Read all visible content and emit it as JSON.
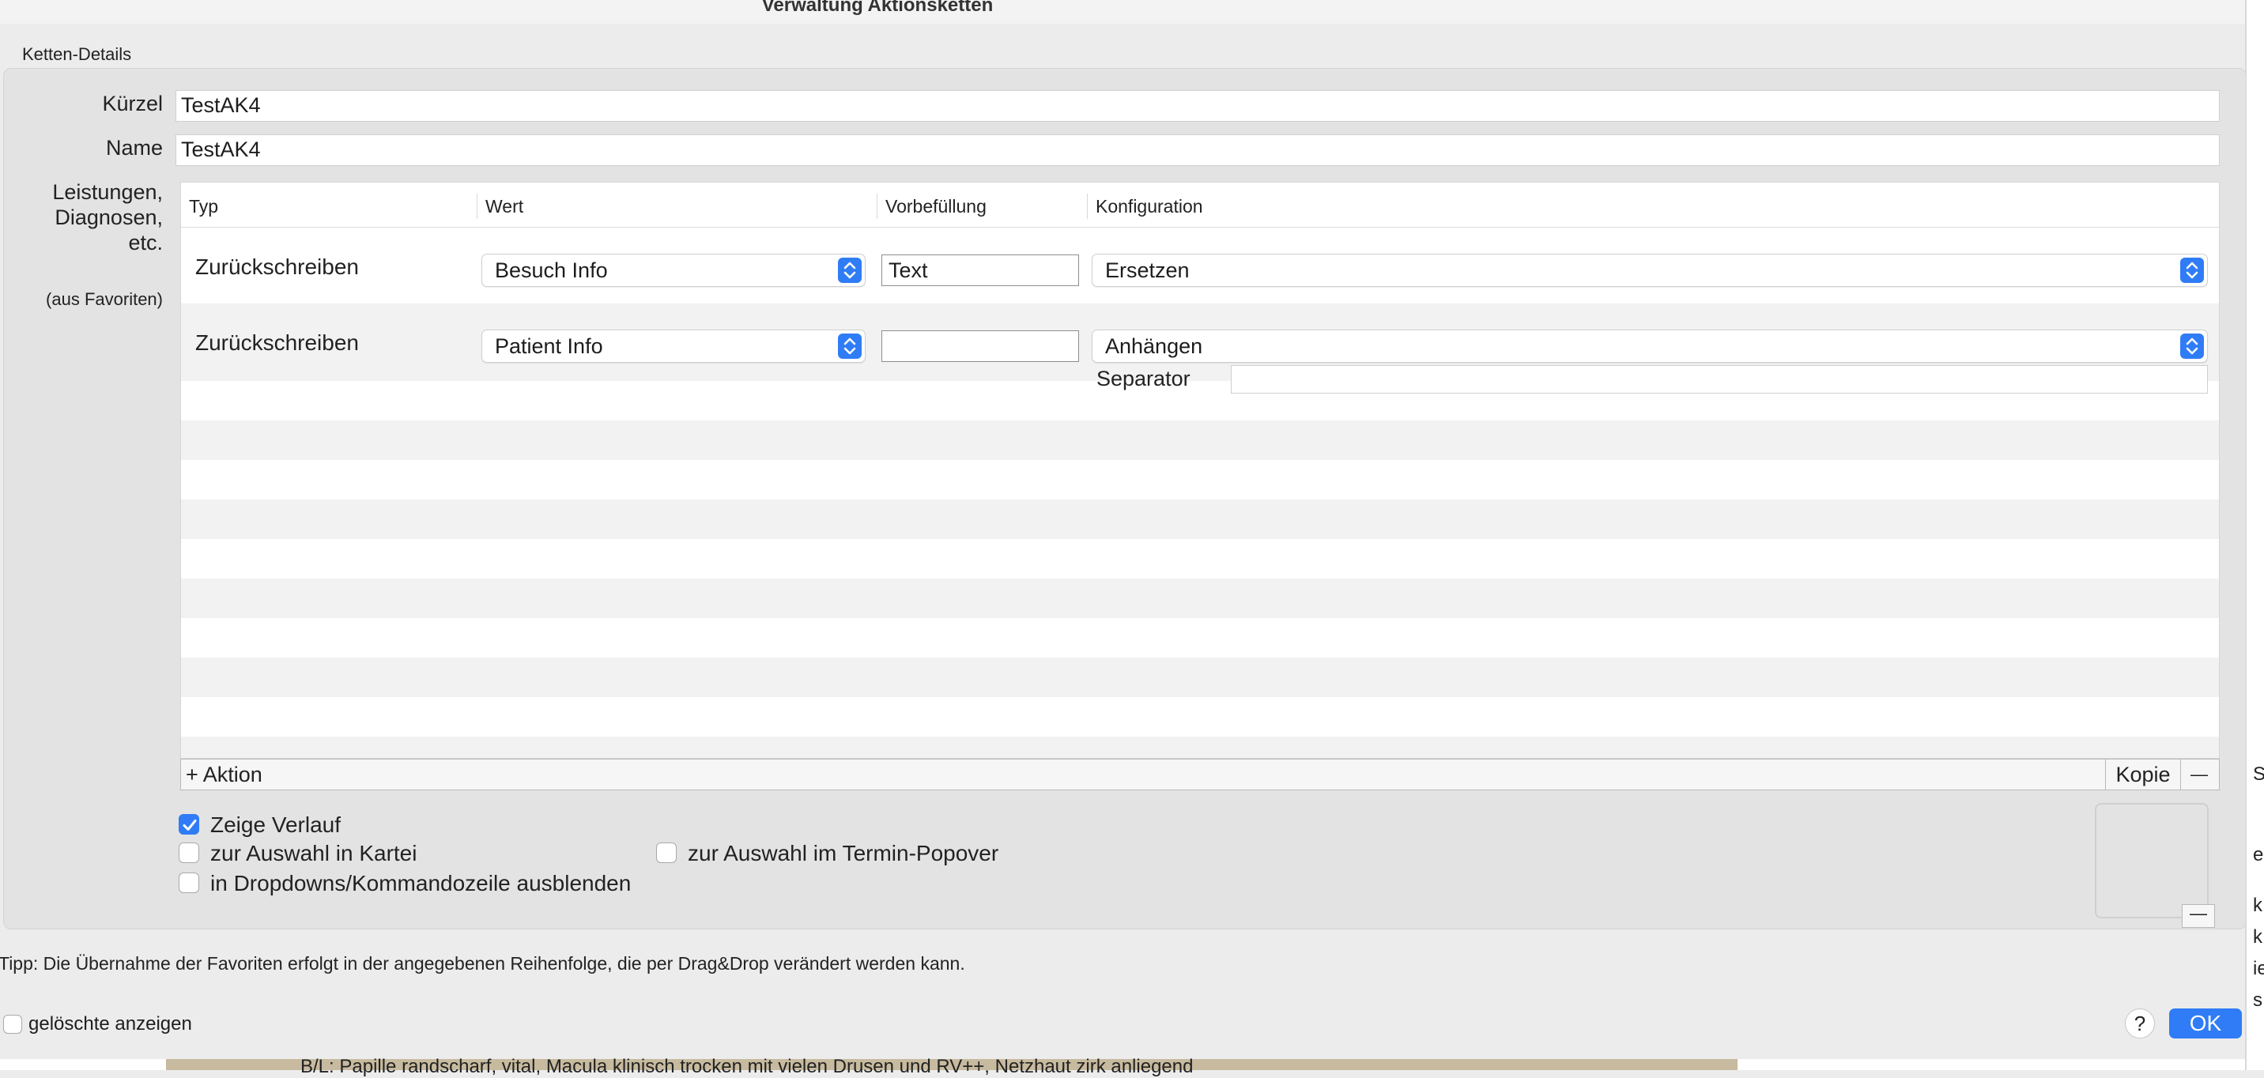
{
  "window": {
    "title": "Verwaltung Aktionsketten"
  },
  "group": {
    "label": "Ketten-Details"
  },
  "form": {
    "kuerzel_label": "Kürzel",
    "kuerzel_value": "TestAK4",
    "name_label": "Name",
    "name_value": "TestAK4",
    "leistungen_label_1": "Leistungen,",
    "leistungen_label_2": "Diagnosen,",
    "leistungen_label_3": "etc.",
    "favoriten_label": "(aus Favoriten)"
  },
  "table": {
    "columns": [
      "Typ",
      "Wert",
      "Vorbefüllung",
      "Konfiguration"
    ],
    "rows": [
      {
        "typ": "Zurückschreiben",
        "wert": "Besuch Info",
        "vorbefuellung": "Text",
        "konfiguration": "Ersetzen"
      },
      {
        "typ": "Zurückschreiben",
        "wert": "Patient Info",
        "vorbefuellung": "",
        "konfiguration": "Anhängen",
        "extra_label": "Separator",
        "extra_value": ""
      }
    ]
  },
  "bar": {
    "add_label": "+ Aktion",
    "copy_label": "Kopie",
    "remove_label": "—"
  },
  "options": {
    "zeige_verlauf": {
      "label": "Zeige Verlauf",
      "checked": true
    },
    "auswahl_kartei": {
      "label": "zur Auswahl in Kartei",
      "checked": false
    },
    "auswahl_termin": {
      "label": "zur Auswahl im Termin-Popover",
      "checked": false
    },
    "dropdown_ausblenden": {
      "label": "in Dropdowns/Kommandozeile ausblenden",
      "checked": false
    }
  },
  "well_minus_label": "—",
  "tip": "Tipp: Die Übernahme der Favoriten erfolgt in der angegebenen Reihenfolge, die per Drag&Drop verändert werden kann.",
  "footer": {
    "show_deleted_label": "gelöschte anzeigen",
    "help_label": "?",
    "ok_label": "OK"
  },
  "background": {
    "bottom_row_text": "B/L: Papille randscharf, vital, Macula klinisch trocken mit vielen Drusen und RV++, Netzhaut zirk anliegend",
    "right_edge_chars": [
      "S",
      "e",
      "k",
      "k",
      "ie",
      "s"
    ]
  },
  "colors": {
    "accent": "#2f7cf6"
  }
}
